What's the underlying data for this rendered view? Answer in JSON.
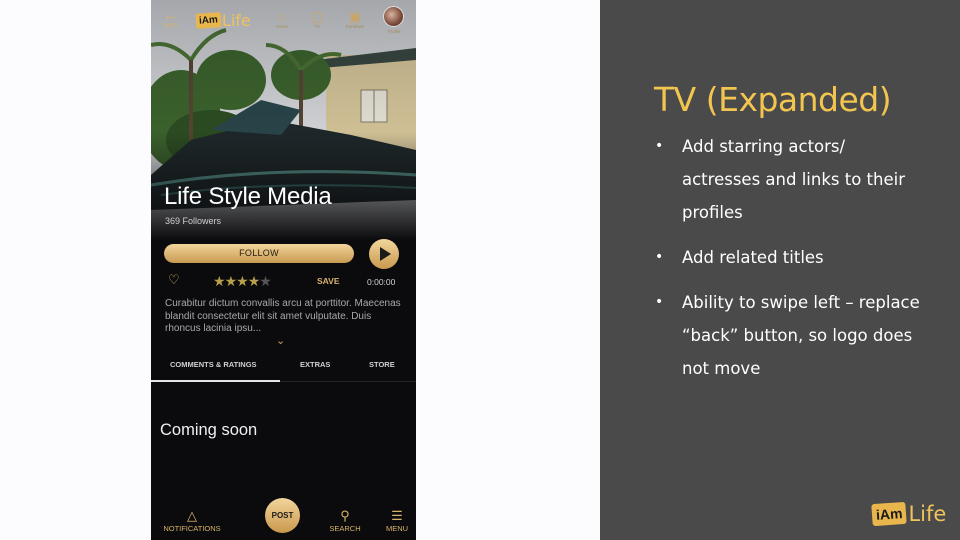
{
  "phone": {
    "topbar": {
      "back_label": "BACK",
      "logo": {
        "iam": "iAm",
        "life": "Life"
      },
      "nav": [
        {
          "label": "Home",
          "icon": "home-icon"
        },
        {
          "label": "TV",
          "icon": "tv-icon"
        },
        {
          "label": "Furniture",
          "icon": "sofa-icon"
        },
        {
          "label": "Profile",
          "icon": "avatar"
        }
      ]
    },
    "hero": {
      "title": "Life Style Media",
      "followers": "369 Followers"
    },
    "actions": {
      "follow_label": "FOLLOW",
      "save_label": "SAVE",
      "time": "0:00:00",
      "rating": 4,
      "rating_max": 5
    },
    "description": "Curabitur dictum convallis arcu at porttitor. Maecenas blandit consectetur elit sit amet vulputate. Duis rhoncus lacinia ipsu...",
    "tabs": [
      {
        "label": "COMMENTS & RATINGS",
        "active": true
      },
      {
        "label": "EXTRAS",
        "active": false
      },
      {
        "label": "STORE",
        "active": false
      }
    ],
    "content_text": "Coming soon",
    "bottombar": {
      "notifications_label": "NOTIFICATIONS",
      "post_label": "POST",
      "search_label": "SEARCH",
      "menu_label": "MENU"
    }
  },
  "panel": {
    "title": "TV (Expanded)",
    "bullets": [
      "Add starring actors/ actresses and links to their profiles",
      "Add related titles",
      "Ability to swipe left – replace “back” button, so logo does not move"
    ],
    "logo": {
      "iam": "iAm",
      "life": "Life"
    }
  },
  "colors": {
    "accent_gold": "#f2c64e",
    "panel_bg": "#4a4a4b",
    "phone_bg": "#0b0b0d"
  }
}
